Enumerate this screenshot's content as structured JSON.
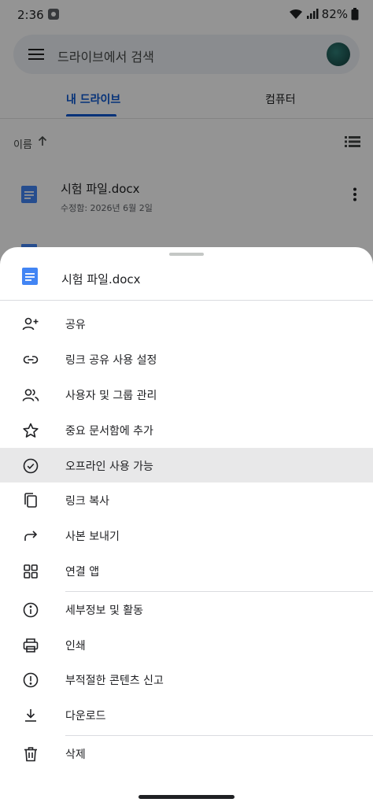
{
  "status_bar": {
    "time": "2:36",
    "battery": "82%"
  },
  "search": {
    "placeholder": "드라이브에서 검색"
  },
  "tabs": [
    {
      "label": "내 드라이브"
    },
    {
      "label": "컴퓨터"
    }
  ],
  "sort": {
    "label": "이름"
  },
  "file": {
    "name": "시험 파일.docx",
    "modified": "수정함: 2026년 6월 2일"
  },
  "sheet": {
    "title": "시험 파일.docx",
    "items": [
      {
        "label": "공유",
        "icon": "person-add-icon"
      },
      {
        "label": "링크 공유 사용 설정",
        "icon": "link-icon"
      },
      {
        "label": "사용자 및 그룹 관리",
        "icon": "people-icon"
      },
      {
        "label": "중요 문서함에 추가",
        "icon": "star-icon"
      },
      {
        "label": "오프라인 사용 가능",
        "icon": "offline-check-icon"
      },
      {
        "label": "링크 복사",
        "icon": "copy-icon"
      },
      {
        "label": "사본 보내기",
        "icon": "forward-icon"
      },
      {
        "label": "연결 앱",
        "icon": "apps-grid-icon"
      },
      {
        "label": "세부정보 및 활동",
        "icon": "info-icon"
      },
      {
        "label": "인쇄",
        "icon": "print-icon"
      },
      {
        "label": "부적절한 콘텐츠 신고",
        "icon": "report-icon"
      },
      {
        "label": "다운로드",
        "icon": "download-icon"
      },
      {
        "label": "삭제",
        "icon": "trash-icon"
      }
    ]
  },
  "colors": {
    "accent": "#0b57d0",
    "doc_blue": "#4285f4",
    "highlight": "#e8e8e9"
  }
}
